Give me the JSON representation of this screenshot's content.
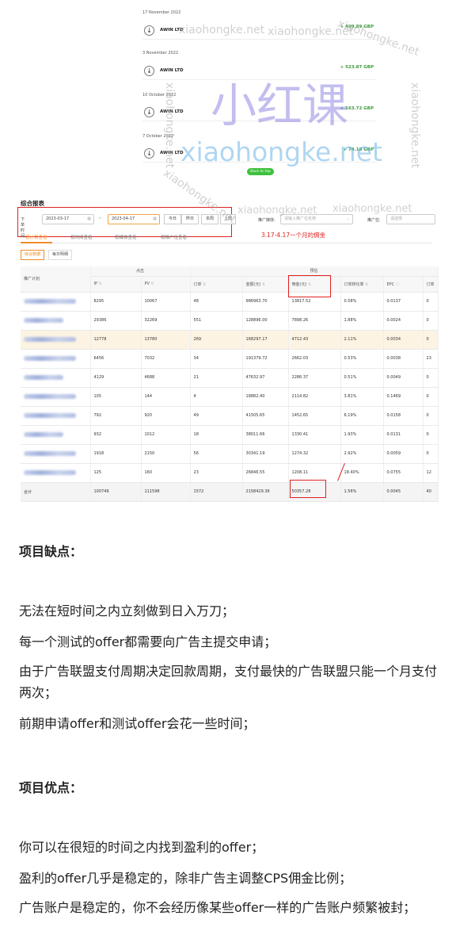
{
  "payout": {
    "entries": [
      {
        "date": "17 November 2022",
        "name": "AWIN LTD",
        "amount": "+ 499.89 GBP"
      },
      {
        "date": "3 November 2022",
        "name": "AWIN LTD",
        "amount": "+ 523.87 GBP"
      },
      {
        "date": "10 October 2022",
        "name": "AWIN LTD",
        "amount": "+ 163.72 GBP"
      },
      {
        "date": "7 October 2022",
        "name": "AWIN LTD",
        "amount": "+ 74.18 GBP"
      }
    ],
    "back_to_top": "Back to top",
    "icon": "arrow-down-icon"
  },
  "report": {
    "title": "综合报表",
    "filters": {
      "date_label": "下单时间:",
      "start_date": "2023-03-17",
      "end_date": "2023-04-17",
      "separator": "~",
      "quick_buttons": [
        "今日",
        "昨日",
        "本周",
        "上周"
      ],
      "media_label": "推广媒体:",
      "media_placeholder": "请输入推广位名称",
      "position_label": "推广位:",
      "position_placeholder": "请选择"
    },
    "note": "3.17-4.17一个月的佣金",
    "tabs": [
      "按计划查看",
      "按时间查看",
      "按媒体查看",
      "按推广位查看"
    ],
    "subtabs": [
      "综合数据",
      "每日明细"
    ],
    "group_headers": {
      "click": "点击",
      "estimate": "预估"
    },
    "columns": [
      "推广计划",
      "IP",
      "PV",
      "订单",
      "金额(元)",
      "佣金(元)",
      "订单转化率",
      "EPC",
      "订单"
    ],
    "rows": [
      {
        "ip": "8295",
        "pv": "10067",
        "orders": "48",
        "amount": "986963.70",
        "commission": "13817.52",
        "rate": "0.58%",
        "epc": "0.0137",
        "extra": "0"
      },
      {
        "ip": "29386",
        "pv": "32269",
        "orders": "551",
        "amount": "128896.00",
        "commission": "7898.26",
        "rate": "1.88%",
        "epc": "0.0024",
        "extra": "0"
      },
      {
        "ip": "12778",
        "pv": "13780",
        "orders": "269",
        "amount": "168297.17",
        "commission": "4712.43",
        "rate": "2.11%",
        "epc": "0.0034",
        "extra": "0"
      },
      {
        "ip": "6456",
        "pv": "7032",
        "orders": "34",
        "amount": "191379.72",
        "commission": "2662.03",
        "rate": "0.53%",
        "epc": "0.0038",
        "extra": "23"
      },
      {
        "ip": "4129",
        "pv": "4688",
        "orders": "21",
        "amount": "47632.97",
        "commission": "2286.37",
        "rate": "0.51%",
        "epc": "0.0049",
        "extra": "0"
      },
      {
        "ip": "105",
        "pv": "144",
        "orders": "4",
        "amount": "18882.40",
        "commission": "2114.82",
        "rate": "3.81%",
        "epc": "0.1469",
        "extra": "0"
      },
      {
        "ip": "792",
        "pv": "920",
        "orders": "49",
        "amount": "41505.65",
        "commission": "1452.65",
        "rate": "6.19%",
        "epc": "0.0158",
        "extra": "0"
      },
      {
        "ip": "932",
        "pv": "1012",
        "orders": "18",
        "amount": "38011.66",
        "commission": "1330.41",
        "rate": "1.93%",
        "epc": "0.0131",
        "extra": "0"
      },
      {
        "ip": "1918",
        "pv": "2150",
        "orders": "56",
        "amount": "30341.19",
        "commission": "1274.32",
        "rate": "2.92%",
        "epc": "0.0059",
        "extra": "0"
      },
      {
        "ip": "125",
        "pv": "160",
        "orders": "23",
        "amount": "26846.55",
        "commission": "1208.11",
        "rate": "18.40%",
        "epc": "0.0755",
        "extra": "12"
      }
    ],
    "total": {
      "label": "合计",
      "ip": "100749",
      "pv": "111598",
      "orders": "1572",
      "amount": "2158429.36",
      "commission": "50357.28",
      "rate": "1.56%",
      "epc": "0.0045",
      "extra": "40"
    }
  },
  "article": {
    "cons_heading": "项目缺点：",
    "cons": [
      "无法在短时间之内立刻做到日入万刀；",
      "每一个测试的offer都需要向广告主提交申请；",
      "由于广告联盟支付周期决定回款周期，支付最快的广告联盟只能一个月支付两次；",
      "前期申请offer和测试offer会花一些时间；"
    ],
    "pros_heading": "项目优点：",
    "pros": [
      "你可以在很短的时间之内找到盈利的offer；",
      "盈利的offer几乎是稳定的，除非广告主调整CPS佣金比例；",
      "广告账户是稳定的，你不会经历像某些offer一样的广告账户频繁被封；"
    ]
  },
  "watermark": {
    "brand": "小红课",
    "url": "xiaohongke.net",
    "small": "xiaohongke.net"
  }
}
